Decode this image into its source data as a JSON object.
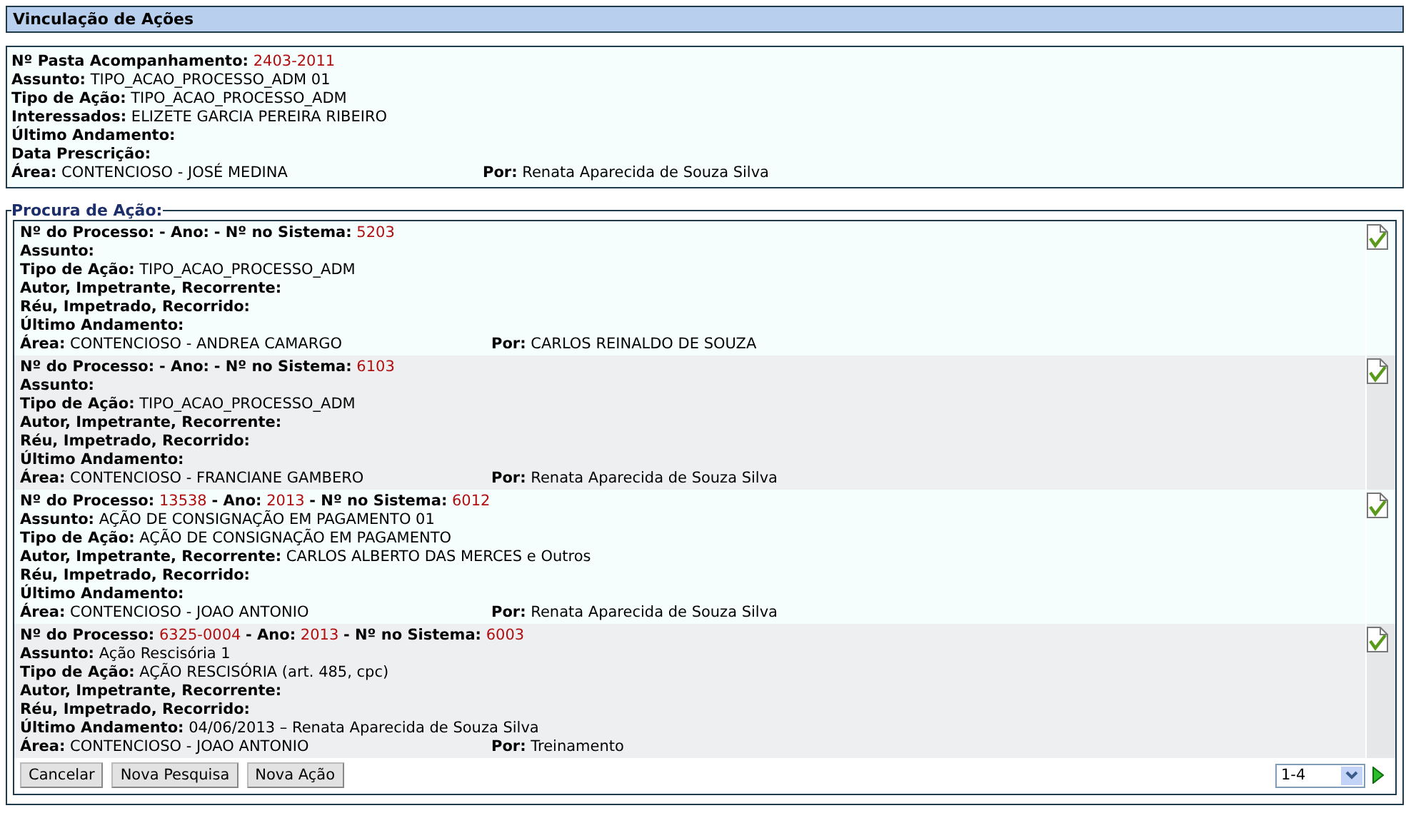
{
  "title": "Vinculação de Ações",
  "pasta": {
    "header": {
      "label": "Nº Pasta Acompanhamento:",
      "value": "2403-2011"
    },
    "fields": [
      {
        "label": "Assunto:",
        "value": "TIPO_ACAO_PROCESSO_ADM 01"
      },
      {
        "label": "Tipo de Ação:",
        "value": "TIPO_ACAO_PROCESSO_ADM"
      },
      {
        "label": "Interessados:",
        "value": "ELIZETE GARCIA PEREIRA RIBEIRO"
      },
      {
        "label": "Último Andamento:"
      },
      {
        "label": "Data Prescrição:"
      }
    ],
    "area": {
      "label": "Área:",
      "value": "CONTENCIOSO - JOSÉ MEDINA"
    },
    "por": {
      "label": "Por:",
      "value": "Renata Aparecida de Souza Silva"
    }
  },
  "search": {
    "legend": "Procura de Ação:",
    "results": [
      {
        "header": [
          {
            "label": "Nº do Processo:"
          },
          {
            "label": "- Ano:"
          },
          {
            "label": "- Nº no Sistema:",
            "value": "5203"
          }
        ],
        "fields": [
          {
            "label": "Assunto:"
          },
          {
            "label": "Tipo de Ação:",
            "value": "TIPO_ACAO_PROCESSO_ADM"
          },
          {
            "label": "Autor, Impetrante, Recorrente:"
          },
          {
            "label": "Réu, Impetrado, Recorrido:"
          },
          {
            "label": "Último Andamento:"
          }
        ],
        "area": {
          "label": "Área:",
          "value": "CONTENCIOSO - ANDREA CAMARGO"
        },
        "por": {
          "label": "Por:",
          "value": "CARLOS REINALDO DE SOUZA"
        }
      },
      {
        "header": [
          {
            "label": "Nº do Processo:"
          },
          {
            "label": "- Ano:"
          },
          {
            "label": "- Nº no Sistema:",
            "value": "6103"
          }
        ],
        "fields": [
          {
            "label": "Assunto:"
          },
          {
            "label": "Tipo de Ação:",
            "value": "TIPO_ACAO_PROCESSO_ADM"
          },
          {
            "label": "Autor, Impetrante, Recorrente:"
          },
          {
            "label": "Réu, Impetrado, Recorrido:"
          },
          {
            "label": "Último Andamento:"
          }
        ],
        "area": {
          "label": "Área:",
          "value": "CONTENCIOSO - FRANCIANE GAMBERO"
        },
        "por": {
          "label": "Por:",
          "value": "Renata Aparecida de Souza Silva"
        }
      },
      {
        "header": [
          {
            "label": "Nº do Processo:",
            "value": "13538"
          },
          {
            "label": "- Ano:",
            "value": "2013"
          },
          {
            "label": "- Nº no Sistema:",
            "value": "6012"
          }
        ],
        "fields": [
          {
            "label": "Assunto:",
            "value": "AÇÃO DE CONSIGNAÇÃO EM PAGAMENTO 01"
          },
          {
            "label": "Tipo de Ação:",
            "value": "AÇÃO DE CONSIGNAÇÃO EM PAGAMENTO"
          },
          {
            "label": "Autor, Impetrante, Recorrente:",
            "value": "CARLOS ALBERTO DAS MERCES e Outros"
          },
          {
            "label": "Réu, Impetrado, Recorrido:"
          },
          {
            "label": "Último Andamento:"
          }
        ],
        "area": {
          "label": "Área:",
          "value": "CONTENCIOSO - JOAO ANTONIO"
        },
        "por": {
          "label": "Por:",
          "value": "Renata Aparecida de Souza Silva"
        }
      },
      {
        "header": [
          {
            "label": "Nº do Processo:",
            "value": "6325-0004"
          },
          {
            "label": "- Ano:",
            "value": "2013"
          },
          {
            "label": "- Nº no Sistema:",
            "value": "6003"
          }
        ],
        "fields": [
          {
            "label": "Assunto:",
            "value": "Ação Rescisória 1"
          },
          {
            "label": "Tipo de Ação:",
            "value": "AÇÃO RESCISÓRIA (art. 485, cpc)"
          },
          {
            "label": "Autor, Impetrante, Recorrente:"
          },
          {
            "label": "Réu, Impetrado, Recorrido:"
          },
          {
            "label": "Último Andamento:",
            "value": "04/06/2013 – Renata Aparecida de Souza Silva"
          }
        ],
        "area": {
          "label": "Área:",
          "value": "CONTENCIOSO - JOAO ANTONIO"
        },
        "por": {
          "label": "Por:",
          "value": "Treinamento"
        }
      }
    ],
    "buttons": [
      "Cancelar",
      "Nova Pesquisa",
      "Nova Ação"
    ],
    "page_select": {
      "value": "1-4"
    }
  }
}
